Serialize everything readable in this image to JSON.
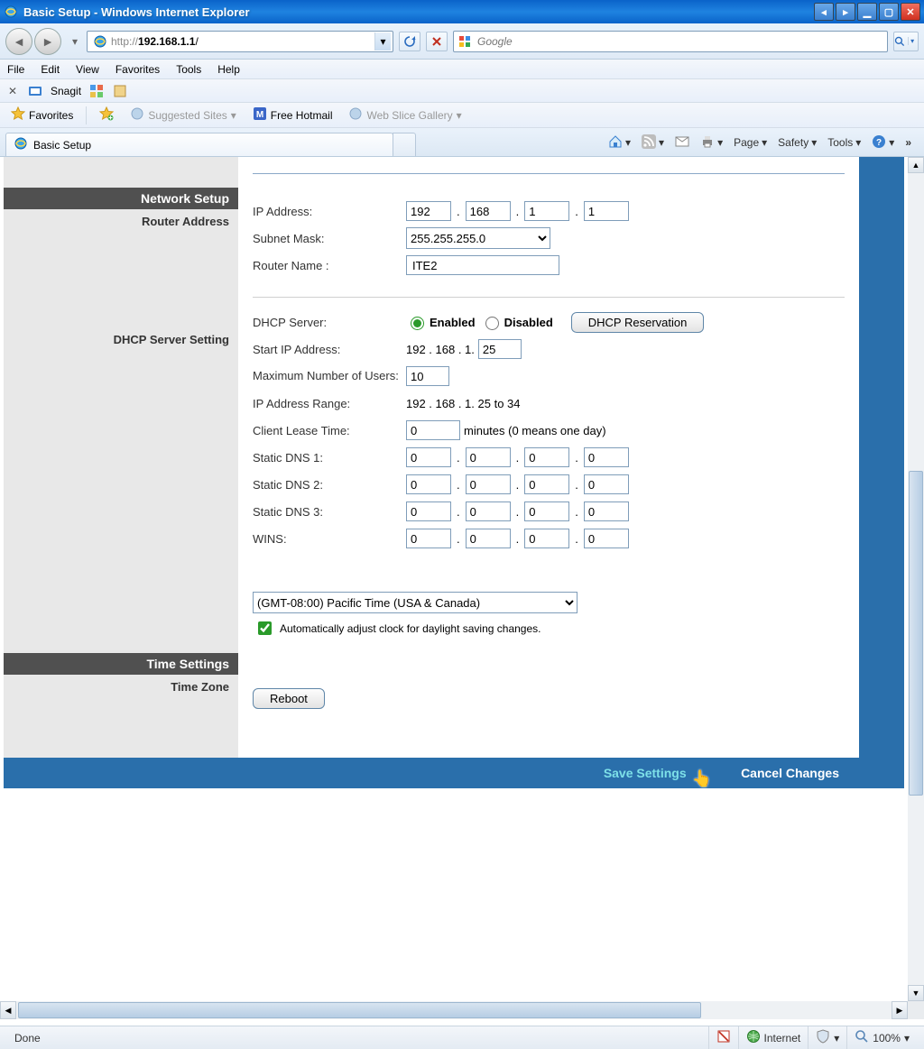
{
  "window": {
    "title": "Basic Setup - Windows Internet Explorer"
  },
  "address": {
    "protocol": "http://",
    "host": "192.168.1.1",
    "path": "/"
  },
  "search": {
    "placeholder": "Google"
  },
  "menu": {
    "file": "File",
    "edit": "Edit",
    "view": "View",
    "favorites": "Favorites",
    "tools": "Tools",
    "help": "Help"
  },
  "snag": {
    "label": "Snagit"
  },
  "favbar": {
    "favorites": "Favorites",
    "suggested": "Suggested Sites",
    "hotmail": "Free Hotmail",
    "webslice": "Web Slice Gallery"
  },
  "tab": {
    "title": "Basic Setup"
  },
  "cmd": {
    "page": "Page",
    "safety": "Safety",
    "tools": "Tools"
  },
  "router": {
    "sections": {
      "network": "Network Setup",
      "router_addr": "Router Address",
      "dhcp": "DHCP Server Setting",
      "time": "Time Settings",
      "timezone": "Time Zone",
      "reboot": "Reboot"
    },
    "labels": {
      "ip": "IP Address:",
      "subnet": "Subnet Mask:",
      "rname": "Router Name :",
      "dhcp_server": "DHCP Server:",
      "enabled": "Enabled",
      "disabled": "Disabled",
      "dhcp_res": "DHCP Reservation",
      "start_ip": "Start IP Address:",
      "start_ip_prefix": "192 . 168 . 1.",
      "max_users": "Maximum Number of Users:",
      "ip_range": "IP Address Range:",
      "ip_range_val": "192 . 168 . 1. 25 to 34",
      "lease": "Client Lease Time:",
      "lease_suffix": "minutes (0 means one day)",
      "dns1": "Static DNS 1:",
      "dns2": "Static DNS 2:",
      "dns3": "Static DNS 3:",
      "wins": "WINS:",
      "tz_select": "(GMT-08:00) Pacific Time (USA & Canada)",
      "dst": "Automatically adjust clock for daylight saving changes.",
      "reboot_btn": "Reboot",
      "save": "Save Settings",
      "cancel": "Cancel Changes"
    },
    "values": {
      "ip": [
        "192",
        "168",
        "1",
        "1"
      ],
      "subnet": "255.255.255.0",
      "rname": "ITE2",
      "start_ip": "25",
      "max_users": "10",
      "lease": "0",
      "dns1": [
        "0",
        "0",
        "0",
        "0"
      ],
      "dns2": [
        "0",
        "0",
        "0",
        "0"
      ],
      "dns3": [
        "0",
        "0",
        "0",
        "0"
      ],
      "wins": [
        "0",
        "0",
        "0",
        "0"
      ]
    }
  },
  "status": {
    "done": "Done",
    "zone": "Internet",
    "zoom": "100%"
  }
}
